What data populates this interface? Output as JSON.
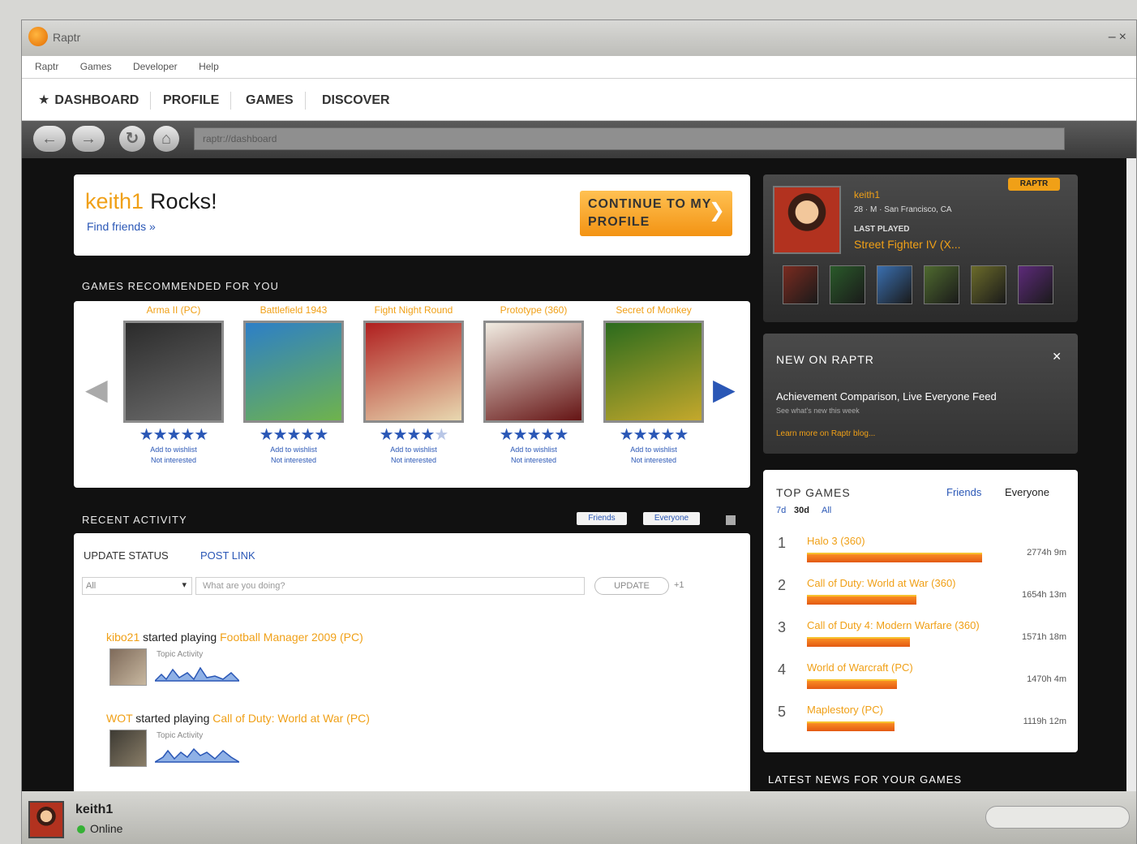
{
  "app": {
    "title": "Raptr"
  },
  "menu": [
    "Raptr",
    "Games",
    "Developer",
    "Help"
  ],
  "nav": [
    "DASHBOARD",
    "PROFILE",
    "GAMES",
    "DISCOVER"
  ],
  "address": "raptr://dashboard",
  "welcome": {
    "username": "keith1",
    "rocks": "Rocks!",
    "find_friends": "Find friends »",
    "continue_btn": "CONTINUE TO MY PROFILE"
  },
  "recommended": {
    "heading": "GAMES RECOMMENDED FOR YOU",
    "items": [
      {
        "title": "Arma II (PC)",
        "rating": 5,
        "colors": [
          "#2b2b2b",
          "#6d6d6d"
        ]
      },
      {
        "title": "Battlefield 1943",
        "rating": 4.5,
        "colors": [
          "#2d7fc7",
          "#6fb34c"
        ]
      },
      {
        "title": "Fight Night Round",
        "rating": 4,
        "colors": [
          "#b01f1f",
          "#e8d8b0"
        ]
      },
      {
        "title": "Prototype (360)",
        "rating": 4.5,
        "colors": [
          "#f1ece2",
          "#651414"
        ]
      },
      {
        "title": "Secret of Monkey",
        "rating": 5,
        "colors": [
          "#2b6b1d",
          "#c4a82c"
        ]
      }
    ],
    "link_add": "Add to wishlist",
    "link_not": "Not interested"
  },
  "recent": {
    "heading": "RECENT ACTIVITY",
    "tab_friends": "Friends",
    "tab_everyone": "Everyone",
    "update_status": "UPDATE STATUS",
    "post_link": "POST LINK",
    "select_value": "All",
    "placeholder": "What are you doing?",
    "update_btn": "UPDATE",
    "count": "+1",
    "activities": [
      {
        "user": "kibo21",
        "verb": "started playing",
        "game": "Football Manager 2009 (PC)",
        "label": "Topic Activity"
      },
      {
        "user": "WOT",
        "verb": "started playing",
        "game": "Call of Duty: World at War (PC)",
        "label": "Topic Activity"
      }
    ]
  },
  "profile": {
    "name": "keith1",
    "info": "28 · M · San Francisco, CA",
    "last_played_label": "LAST PLAYED",
    "last_played": "Street Fighter IV (X...",
    "badge": "RAPTR",
    "tiles": [
      "#7a2b20",
      "#2a5a2a",
      "#3a6fb0",
      "#4f6a2f",
      "#6b6b2a",
      "#5d2a7a"
    ]
  },
  "new_on_raptr": {
    "heading": "NEW ON RAPTR",
    "text": "Achievement Comparison, Live Everyone Feed",
    "sub": "See what's new this week",
    "link": "Learn more on Raptr blog..."
  },
  "top_games": {
    "heading": "TOP GAMES",
    "friends": "Friends",
    "everyone": "Everyone",
    "ranges": [
      "7d",
      "30d",
      "All"
    ],
    "rows": [
      {
        "rank": "1",
        "name": "Halo 3 (360)",
        "value": "2774h 9m",
        "fill": 0.8
      },
      {
        "rank": "2",
        "name": "Call of Duty: World at War (360)",
        "value": "1654h 13m",
        "fill": 0.5
      },
      {
        "rank": "3",
        "name": "Call of Duty 4: Modern Warfare (360)",
        "value": "1571h 18m",
        "fill": 0.47
      },
      {
        "rank": "4",
        "name": "World of Warcraft (PC)",
        "value": "1470h 4m",
        "fill": 0.41
      },
      {
        "rank": "5",
        "name": "Maplestory (PC)",
        "value": "1119h 12m",
        "fill": 0.4
      }
    ]
  },
  "latest_news": "LATEST NEWS FOR YOUR GAMES",
  "status": {
    "name": "keith1",
    "state": "Online"
  }
}
